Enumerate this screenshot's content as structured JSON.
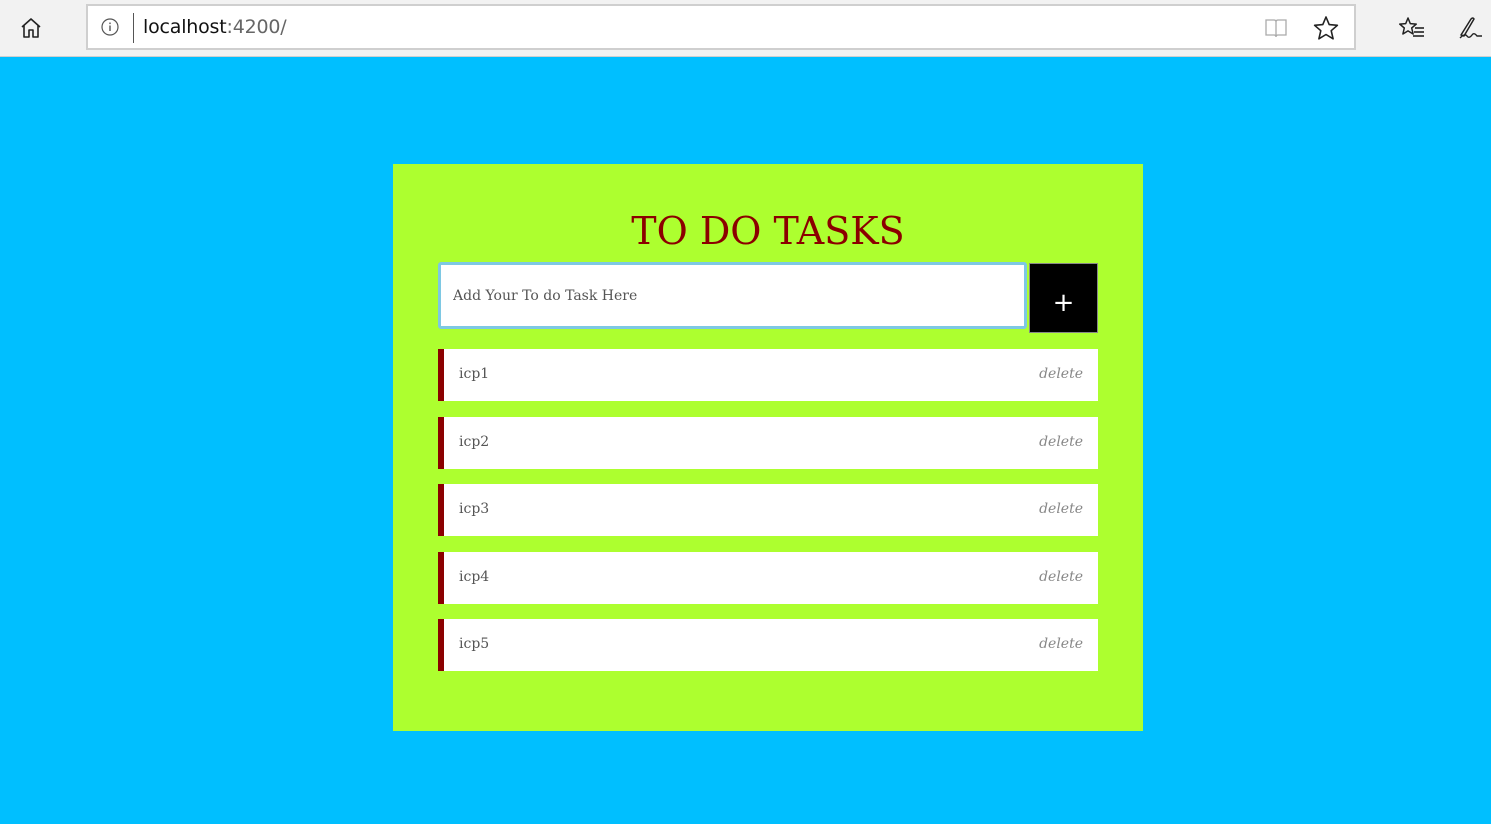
{
  "browser": {
    "url_host": "localhost",
    "url_rest": ":4200/"
  },
  "app": {
    "title": "TO DO TASKS",
    "input_placeholder": "Add Your To do Task Here",
    "add_button_label": "+",
    "tasks": [
      {
        "label": "icp1",
        "action": "delete"
      },
      {
        "label": "icp2",
        "action": "delete"
      },
      {
        "label": "icp3",
        "action": "delete"
      },
      {
        "label": "icp4",
        "action": "delete"
      },
      {
        "label": "icp5",
        "action": "delete"
      }
    ]
  },
  "colors": {
    "page_background": "#00bfff",
    "card_background": "#adff2f",
    "title": "#8b0000",
    "task_accent": "#8b0000",
    "add_button": "#000000"
  }
}
